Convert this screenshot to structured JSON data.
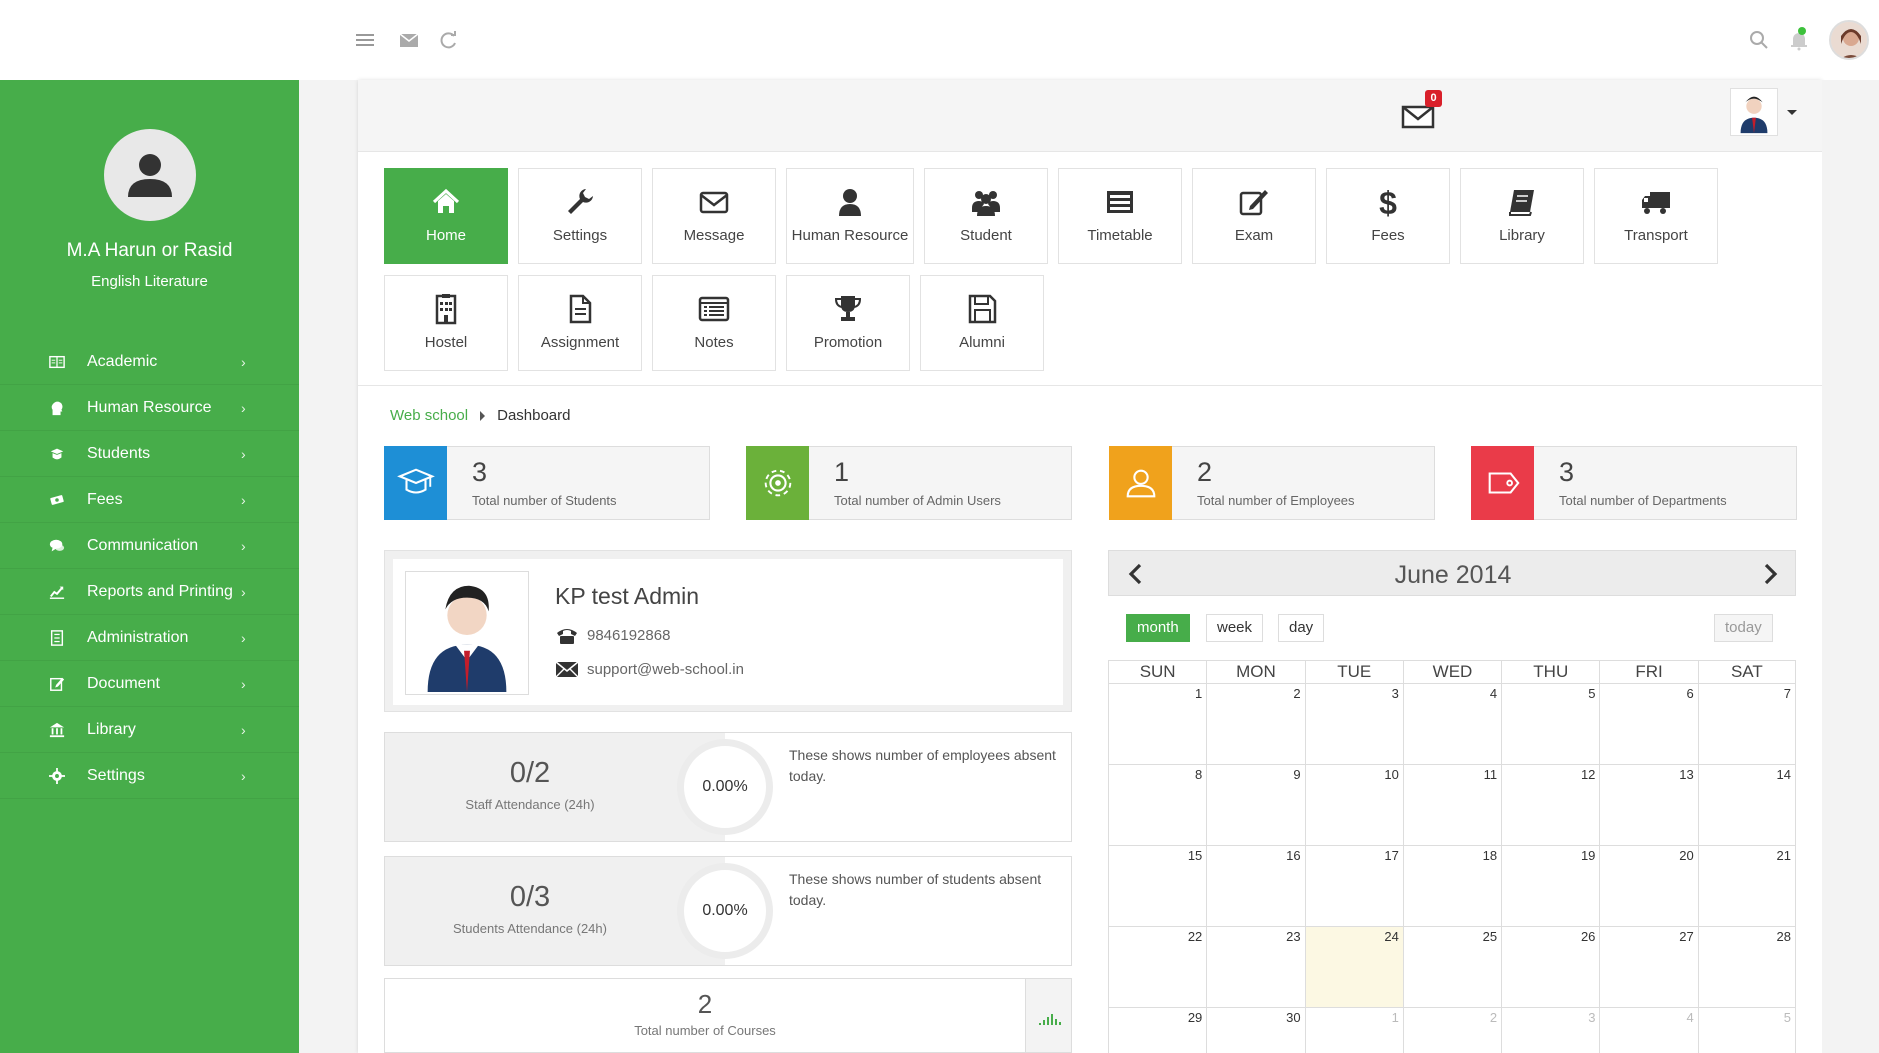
{
  "topbar": {
    "icons": [
      "menu-icon",
      "mail-icon",
      "refresh-icon",
      "search-icon",
      "bell-icon",
      "user-avatar"
    ]
  },
  "sidebar": {
    "user_name": "M.A Harun or Rasid",
    "user_subtitle": "English Literature",
    "items": [
      {
        "label": "Academic",
        "icon": "academic-icon"
      },
      {
        "label": "Human Resource",
        "icon": "human-resource-icon"
      },
      {
        "label": "Students",
        "icon": "students-icon"
      },
      {
        "label": "Fees",
        "icon": "fees-icon"
      },
      {
        "label": "Communication",
        "icon": "communication-icon"
      },
      {
        "label": "Reports and Printing",
        "icon": "reports-icon"
      },
      {
        "label": "Administration",
        "icon": "administration-icon"
      },
      {
        "label": "Document",
        "icon": "document-icon"
      },
      {
        "label": "Library",
        "icon": "library-icon"
      },
      {
        "label": "Settings",
        "icon": "settings-icon"
      }
    ]
  },
  "header": {
    "mail_badge": "0"
  },
  "tiles": [
    {
      "label": "Home",
      "icon": "home-icon",
      "active": true
    },
    {
      "label": "Settings",
      "icon": "wrench-icon"
    },
    {
      "label": "Message",
      "icon": "envelope-icon"
    },
    {
      "label": "Human Resource",
      "icon": "person-icon"
    },
    {
      "label": "Student",
      "icon": "group-icon"
    },
    {
      "label": "Timetable",
      "icon": "timetable-icon"
    },
    {
      "label": "Exam",
      "icon": "edit-icon"
    },
    {
      "label": "Fees",
      "icon": "dollar-icon"
    },
    {
      "label": "Library",
      "icon": "book-icon"
    },
    {
      "label": "Transport",
      "icon": "truck-icon"
    },
    {
      "label": "Hostel",
      "icon": "building-icon"
    },
    {
      "label": "Assignment",
      "icon": "file-icon"
    },
    {
      "label": "Notes",
      "icon": "list-icon"
    },
    {
      "label": "Promotion",
      "icon": "trophy-icon"
    },
    {
      "label": "Alumni",
      "icon": "save-icon"
    }
  ],
  "breadcrumb": {
    "root": "Web school",
    "current": "Dashboard"
  },
  "stats": [
    {
      "value": "3",
      "label": "Total number of Students",
      "color": "#1e8fd6",
      "icon": "graduation-cap-icon"
    },
    {
      "value": "1",
      "label": "Total number of Admin Users",
      "color": "#6bb13a",
      "icon": "gear-icon"
    },
    {
      "value": "2",
      "label": "Total number of Employees",
      "color": "#f0a21c",
      "icon": "user-icon"
    },
    {
      "value": "3",
      "label": "Total number of Departments",
      "color": "#ea3b49",
      "icon": "tag-icon"
    }
  ],
  "profile": {
    "name": "KP test Admin",
    "phone": "9846192868",
    "email": "support@web-school.in"
  },
  "attendance": [
    {
      "value": "0/2",
      "label": "Staff Attendance (24h)",
      "percent": "0.00%",
      "description": "These shows number of employees absent today."
    },
    {
      "value": "0/3",
      "label": "Students Attendance (24h)",
      "percent": "0.00%",
      "description": "These shows number of students absent today."
    }
  ],
  "courses": {
    "value": "2",
    "label": "Total number of Courses"
  },
  "calendar": {
    "title": "June 2014",
    "buttons": {
      "month": "month",
      "week": "week",
      "day": "day",
      "today": "today"
    },
    "days_of_week": [
      "SUN",
      "MON",
      "TUE",
      "WED",
      "THU",
      "FRI",
      "SAT"
    ],
    "weeks": [
      [
        "1",
        "2",
        "3",
        "4",
        "5",
        "6",
        "7"
      ],
      [
        "8",
        "9",
        "10",
        "11",
        "12",
        "13",
        "14"
      ],
      [
        "15",
        "16",
        "17",
        "18",
        "19",
        "20",
        "21"
      ],
      [
        "22",
        "23",
        "24",
        "25",
        "26",
        "27",
        "28"
      ],
      [
        "29",
        "30",
        "1",
        "2",
        "3",
        "4",
        "5"
      ]
    ],
    "today": "24"
  }
}
